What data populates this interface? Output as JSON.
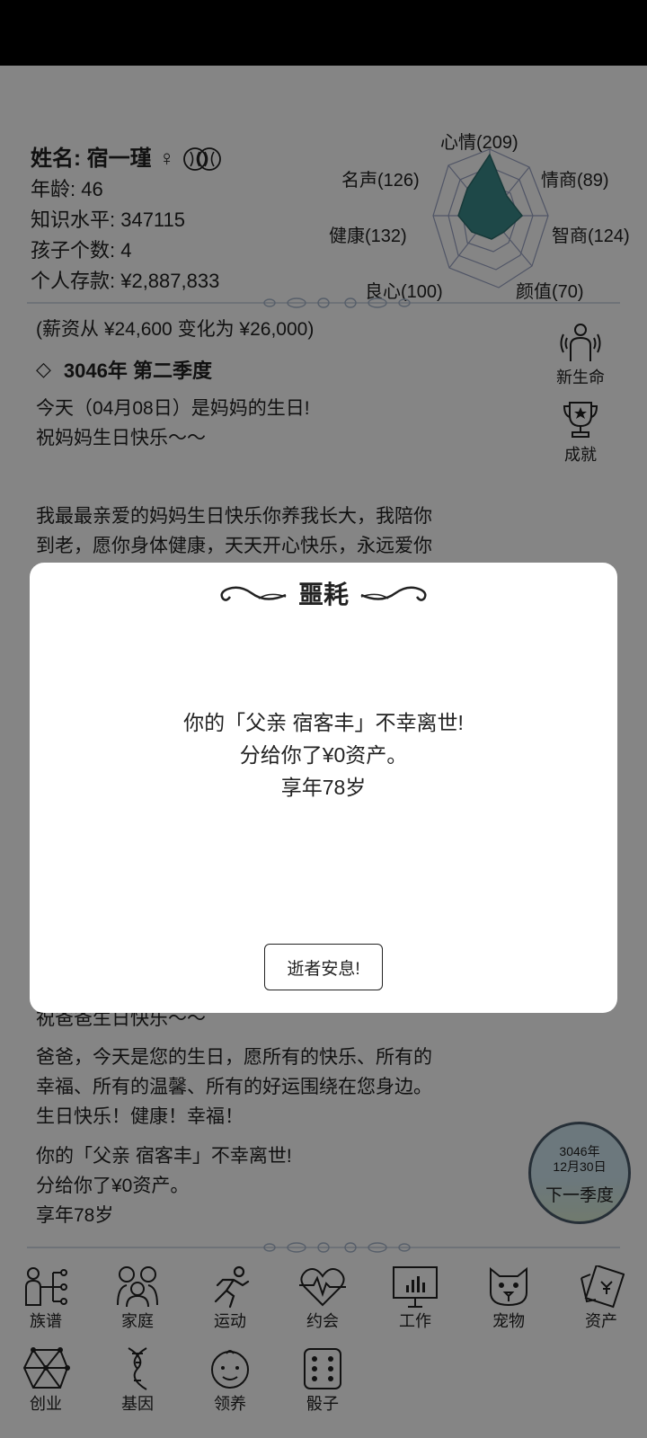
{
  "profile": {
    "name_label": "姓名: 宿一瑾",
    "gender_symbol": "♀",
    "age": "年龄: 46",
    "knowledge": "知识水平: 347115",
    "children": "孩子个数: 4",
    "savings": "个人存款: ¥2,887,833"
  },
  "radar": {
    "mood": "心情(209)",
    "business": "情商(89)",
    "iq": "智商(124)",
    "looks": "颜值(70)",
    "conscience": "良心(100)",
    "health": "健康(132)",
    "fame": "名声(126)",
    "fill_color": "#3a8a8a"
  },
  "log": {
    "salary_change": "(薪资从 ¥24,600 变化为 ¥26,000)",
    "season_icon": "◇",
    "season_title": "3046年 第二季度",
    "entry1_line1": "今天（04月08日）是妈妈的生日!",
    "entry1_line2": "祝妈妈生日快乐～～",
    "entry2_line1": "我最最亲爱的妈妈生日快乐你养我长大，我陪你",
    "entry2_line2": "到老，愿你身体健康，天天开心快乐，永远爱你",
    "entry3_partial": "祝爸爸生日快乐～～",
    "entry4_line1": "爸爸，今天是您的生日，愿所有的快乐、所有的",
    "entry4_line2": "幸福、所有的温馨、所有的好运围绕在您身边。",
    "entry4_line3": "生日快乐！健康！幸福！",
    "entry5_line1": "你的「父亲 宿客丰」不幸离世!",
    "entry5_line2": "分给你了¥0资产。",
    "entry5_line3": "享年78岁"
  },
  "side": {
    "new_life": "新生命",
    "achievement": "成就"
  },
  "next_season": {
    "year": "3046年",
    "date": "12月30日",
    "label": "下一季度"
  },
  "grid": {
    "family_tree": "族谱",
    "family": "家庭",
    "sports": "运动",
    "dating": "约会",
    "work": "工作",
    "pets": "宠物",
    "assets": "资产",
    "startup": "创业",
    "genes": "基因",
    "adopt": "领养",
    "dice": "骰子"
  },
  "modal": {
    "title": "噩耗",
    "line1": "你的「父亲 宿客丰」不幸离世!",
    "line2": "分给你了¥0资产。",
    "line3": "享年78岁",
    "button": "逝者安息!"
  }
}
